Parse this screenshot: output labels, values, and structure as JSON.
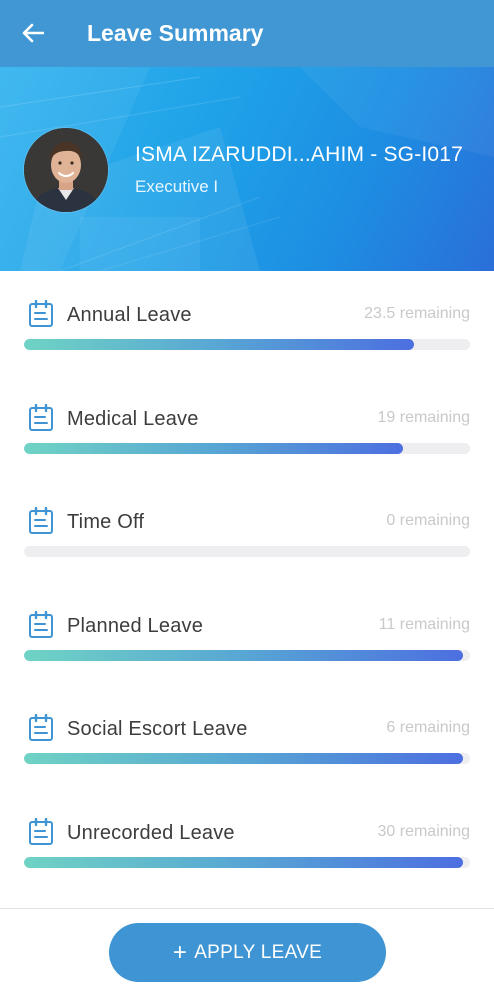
{
  "appbar": {
    "title": "Leave Summary",
    "back_icon": "arrow-left-icon"
  },
  "profile": {
    "name": "ISMA IZARUDDI...AHIM - SG-I017",
    "role": "Executive I"
  },
  "leaves": [
    {
      "name": "Annual Leave",
      "remaining_text": "23.5 remaining",
      "progress_percent": 87.5,
      "icon": "calendar-list-icon"
    },
    {
      "name": "Medical Leave",
      "remaining_text": "19 remaining",
      "progress_percent": 85,
      "icon": "calendar-list-icon"
    },
    {
      "name": "Time Off",
      "remaining_text": "0 remaining",
      "progress_percent": 0,
      "icon": "calendar-list-icon"
    },
    {
      "name": "Planned Leave",
      "remaining_text": "11 remaining",
      "progress_percent": 98.5,
      "icon": "calendar-list-icon"
    },
    {
      "name": "Social Escort Leave",
      "remaining_text": "6 remaining",
      "progress_percent": 98.5,
      "icon": "calendar-list-icon"
    },
    {
      "name": "Unrecorded Leave",
      "remaining_text": "30 remaining",
      "progress_percent": 98.5,
      "icon": "calendar-list-icon"
    }
  ],
  "apply_button": {
    "label": "APPLY LEAVE",
    "icon": "plus-icon"
  },
  "colors": {
    "appbar": "#4197d3",
    "progress_start": "#6fd3c4",
    "progress_end": "#4c6fe0",
    "button": "#3f95d3"
  }
}
